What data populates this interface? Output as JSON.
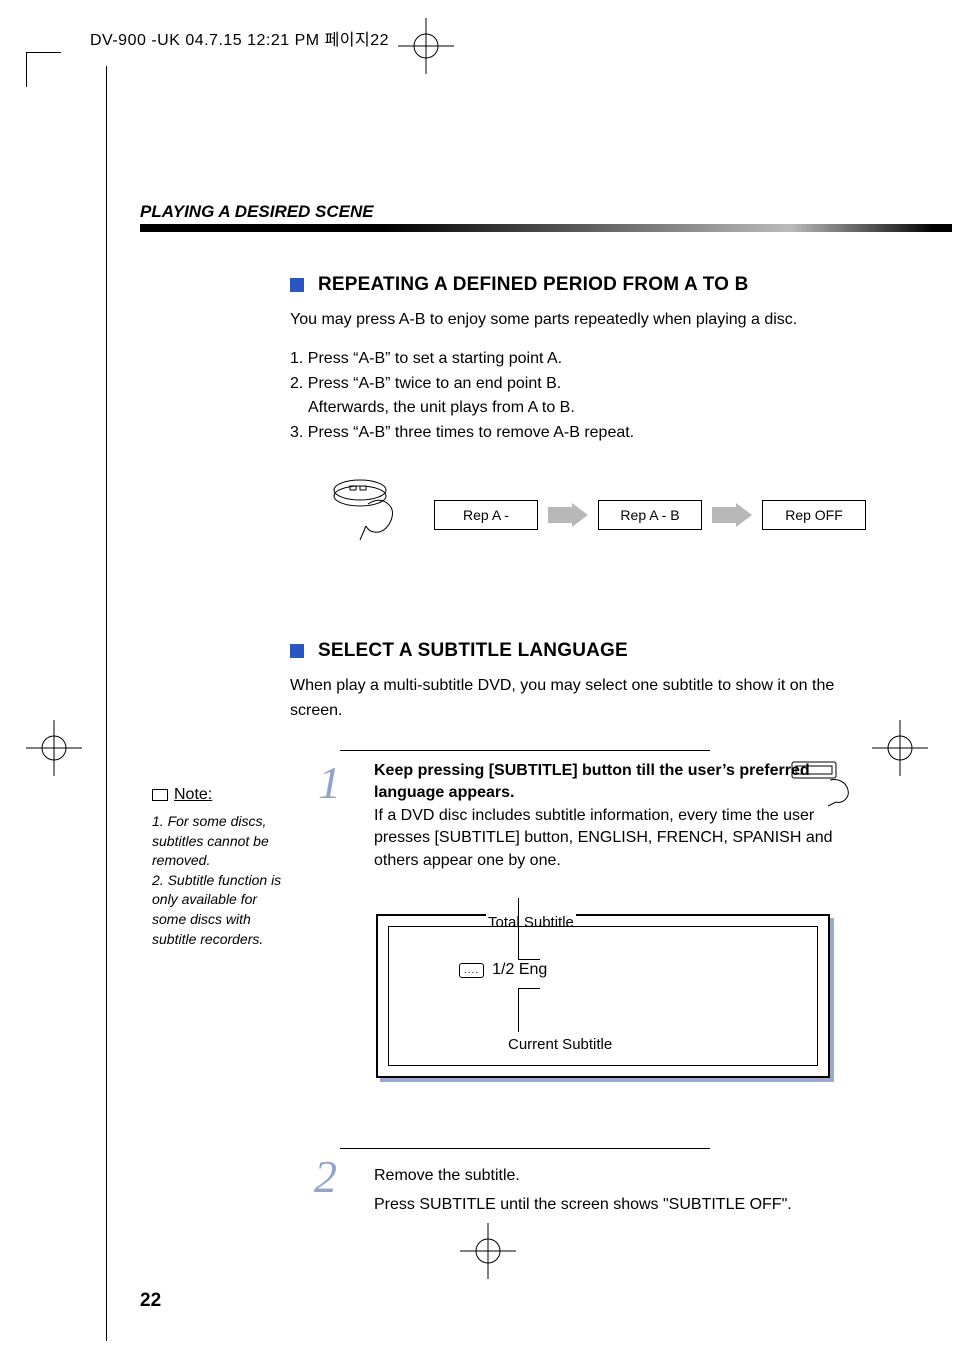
{
  "header": "DV-900 -UK  04.7.15 12:21 PM  페이지22",
  "page_number": "22",
  "section_title": "PLAYING A DESIRED SCENE",
  "section1": {
    "heading": "REPEATING A DEFINED PERIOD FROM A TO B",
    "intro": "You may press A-B to enjoy some parts repeatedly when playing a disc.",
    "step1": "1. Press “A-B” to set a starting point A.",
    "step2": "2. Press “A-B” twice to an end point B.",
    "step2b": "Afterwards, the unit plays from A to B.",
    "step3": "3. Press “A-B” three times to remove A-B repeat.",
    "box1": "Rep A -",
    "box2": "Rep A - B",
    "box3": "Rep OFF"
  },
  "section2": {
    "heading": "SELECT A SUBTITLE LANGUAGE",
    "intro": "When play a multi-subtitle DVD, you may select one subtitle to show it on the screen."
  },
  "step1": {
    "bold": "Keep pressing [SUBTITLE] button till the user’s preferred language appears.",
    "rest": "If a DVD disc includes subtitle information, every time the user presses [SUBTITLE] button, ENGLISH, FRENCH, SPANISH and others appear one by one."
  },
  "tv": {
    "top_label": "Total Subtitle",
    "osd": "1/2 Eng",
    "bottom_label": "Current Subtitle"
  },
  "step2": {
    "line1": "Remove the subtitle.",
    "line2": "Press SUBTITLE until the screen shows \"SUBTITLE OFF\"."
  },
  "note": {
    "title": "Note:",
    "n1": "1. For some discs, subtitles cannot be removed.",
    "n2": "2. Subtitle function is only available for some discs with subtitle recorders."
  },
  "nums": {
    "one": "1",
    "two": "2"
  }
}
